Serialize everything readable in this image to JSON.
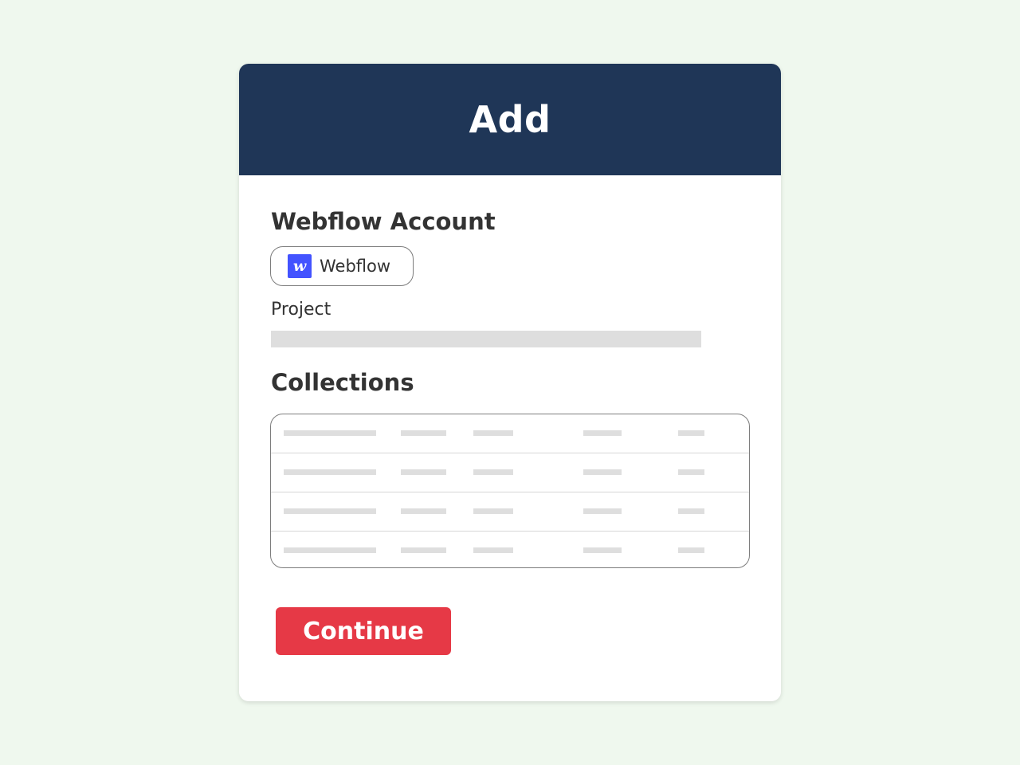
{
  "dialog": {
    "title": "Add"
  },
  "account": {
    "section_title": "Webflow Account",
    "selected": {
      "name": "Webflow",
      "logo_letter": "w",
      "icon": "webflow-logo-icon",
      "brand_color": "#4353ff"
    }
  },
  "project": {
    "label": "Project"
  },
  "collections": {
    "section_title": "Collections",
    "rows": [
      {
        "placeholder": true
      },
      {
        "placeholder": true
      },
      {
        "placeholder": true
      },
      {
        "placeholder": true
      }
    ]
  },
  "actions": {
    "continue_label": "Continue"
  },
  "colors": {
    "background": "#eff8ee",
    "header": "#1f3657",
    "primary_button": "#e63946",
    "placeholder": "#dedede",
    "text": "#333333"
  }
}
